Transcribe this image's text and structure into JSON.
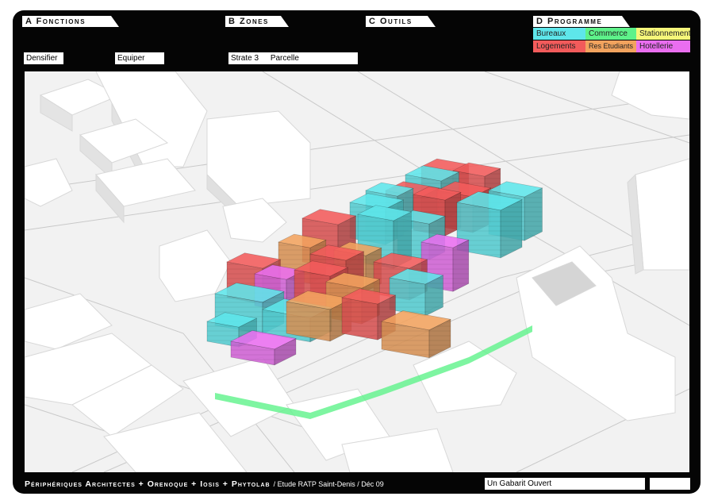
{
  "tabs": {
    "a": "A Fonctions",
    "b": "B Zones",
    "c": "C Outils",
    "d": "D Programme"
  },
  "fields": {
    "densifier": "Densifier",
    "equiper": "Equiper",
    "strate": "Strate 3",
    "parcelle": "Parcelle",
    "gabarit": "Un Gabarit Ouvert",
    "extra": ""
  },
  "legend": [
    {
      "label": "Bureaux",
      "color": "#5ee6ea"
    },
    {
      "label": "Commerce",
      "color": "#5ef28a"
    },
    {
      "label": "Stationnement",
      "color": "#f6f77a"
    },
    {
      "label": "Logements",
      "color": "#f25b5b"
    },
    {
      "label": "Res Etudiants",
      "color": "#f2a35e"
    },
    {
      "label": "Hotellerie",
      "color": "#ea6ef0"
    }
  ],
  "footer": {
    "credits": "Périphériques Architectes + Orenoque + Iosis + Phytolab",
    "study": "/ Etude RATP Saint-Denis / Déc 09"
  }
}
